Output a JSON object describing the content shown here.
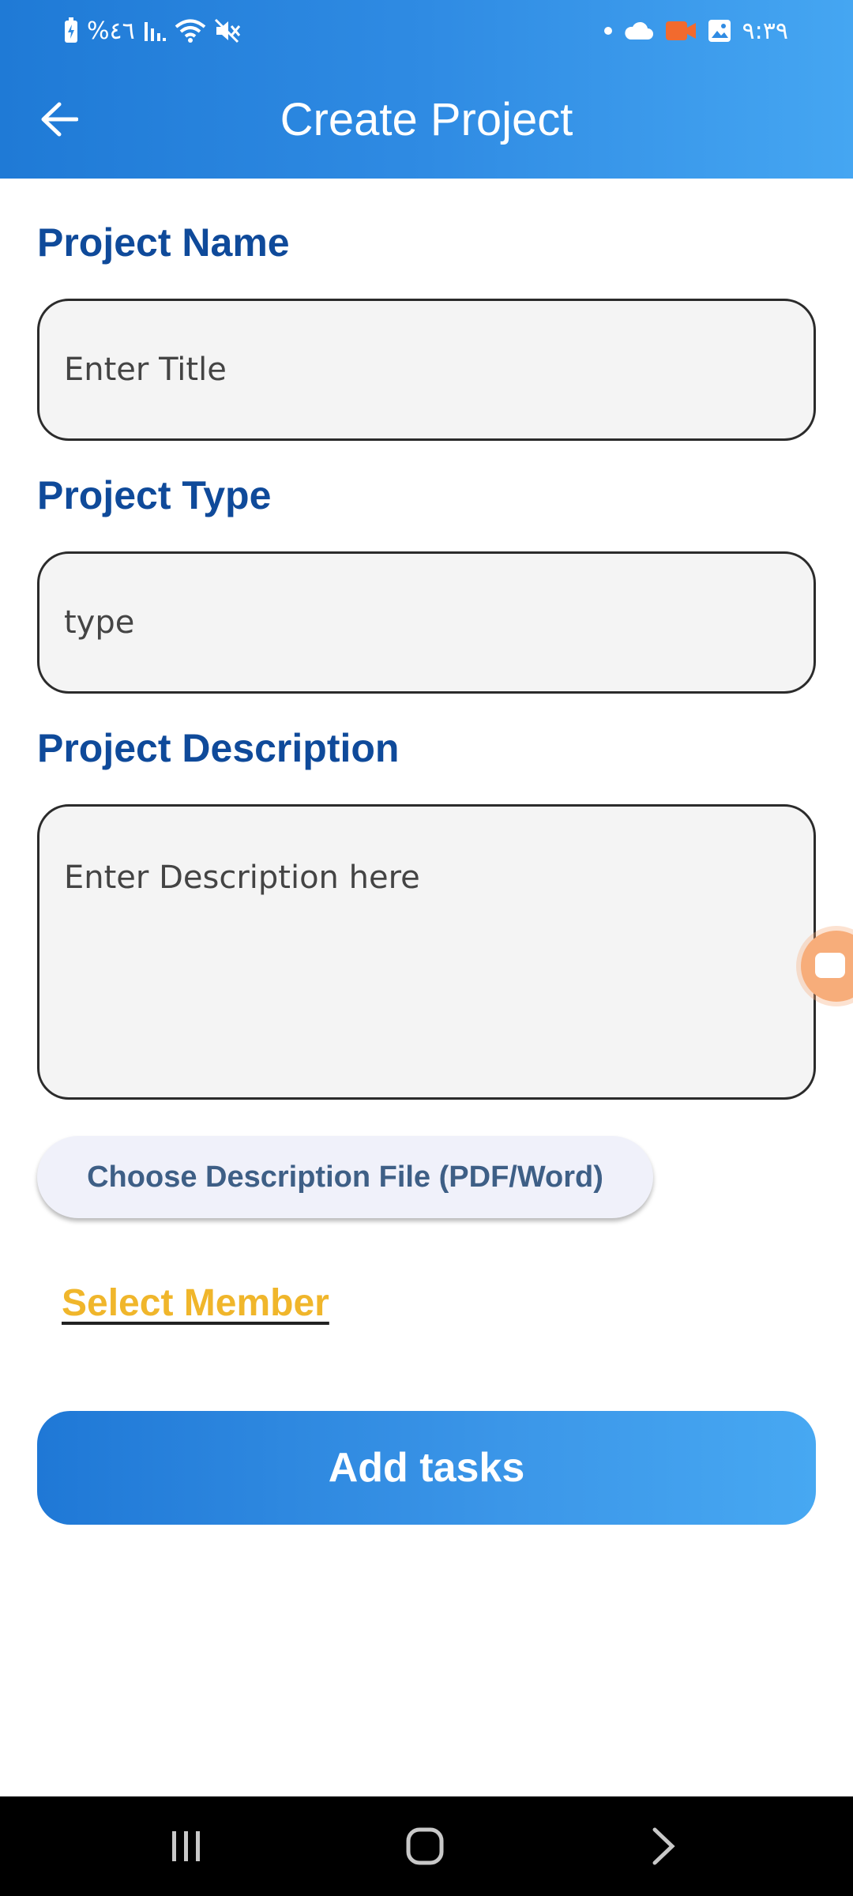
{
  "status_bar": {
    "left_text": "%٤٦",
    "time": "٩:٣٩"
  },
  "app_bar": {
    "title": "Create Project",
    "back_icon": "arrow-left-icon"
  },
  "form": {
    "project_name": {
      "label": "Project Name",
      "placeholder": "Enter Title"
    },
    "project_type": {
      "label": "Project Type",
      "placeholder": "type"
    },
    "project_description": {
      "label": "Project Description",
      "placeholder": "Enter Description here"
    },
    "file_button_label": "Choose Description File (PDF/Word)",
    "select_member_label": "Select Member",
    "add_tasks_label": "Add tasks"
  },
  "colors": {
    "header_start": "#1f7ad6",
    "header_end": "#45a6f2",
    "label": "#0f4a9a",
    "link": "#f0b62b"
  },
  "nav_bar": {
    "icons": [
      "recent-apps-icon",
      "home-icon",
      "back-chevron-icon"
    ]
  }
}
